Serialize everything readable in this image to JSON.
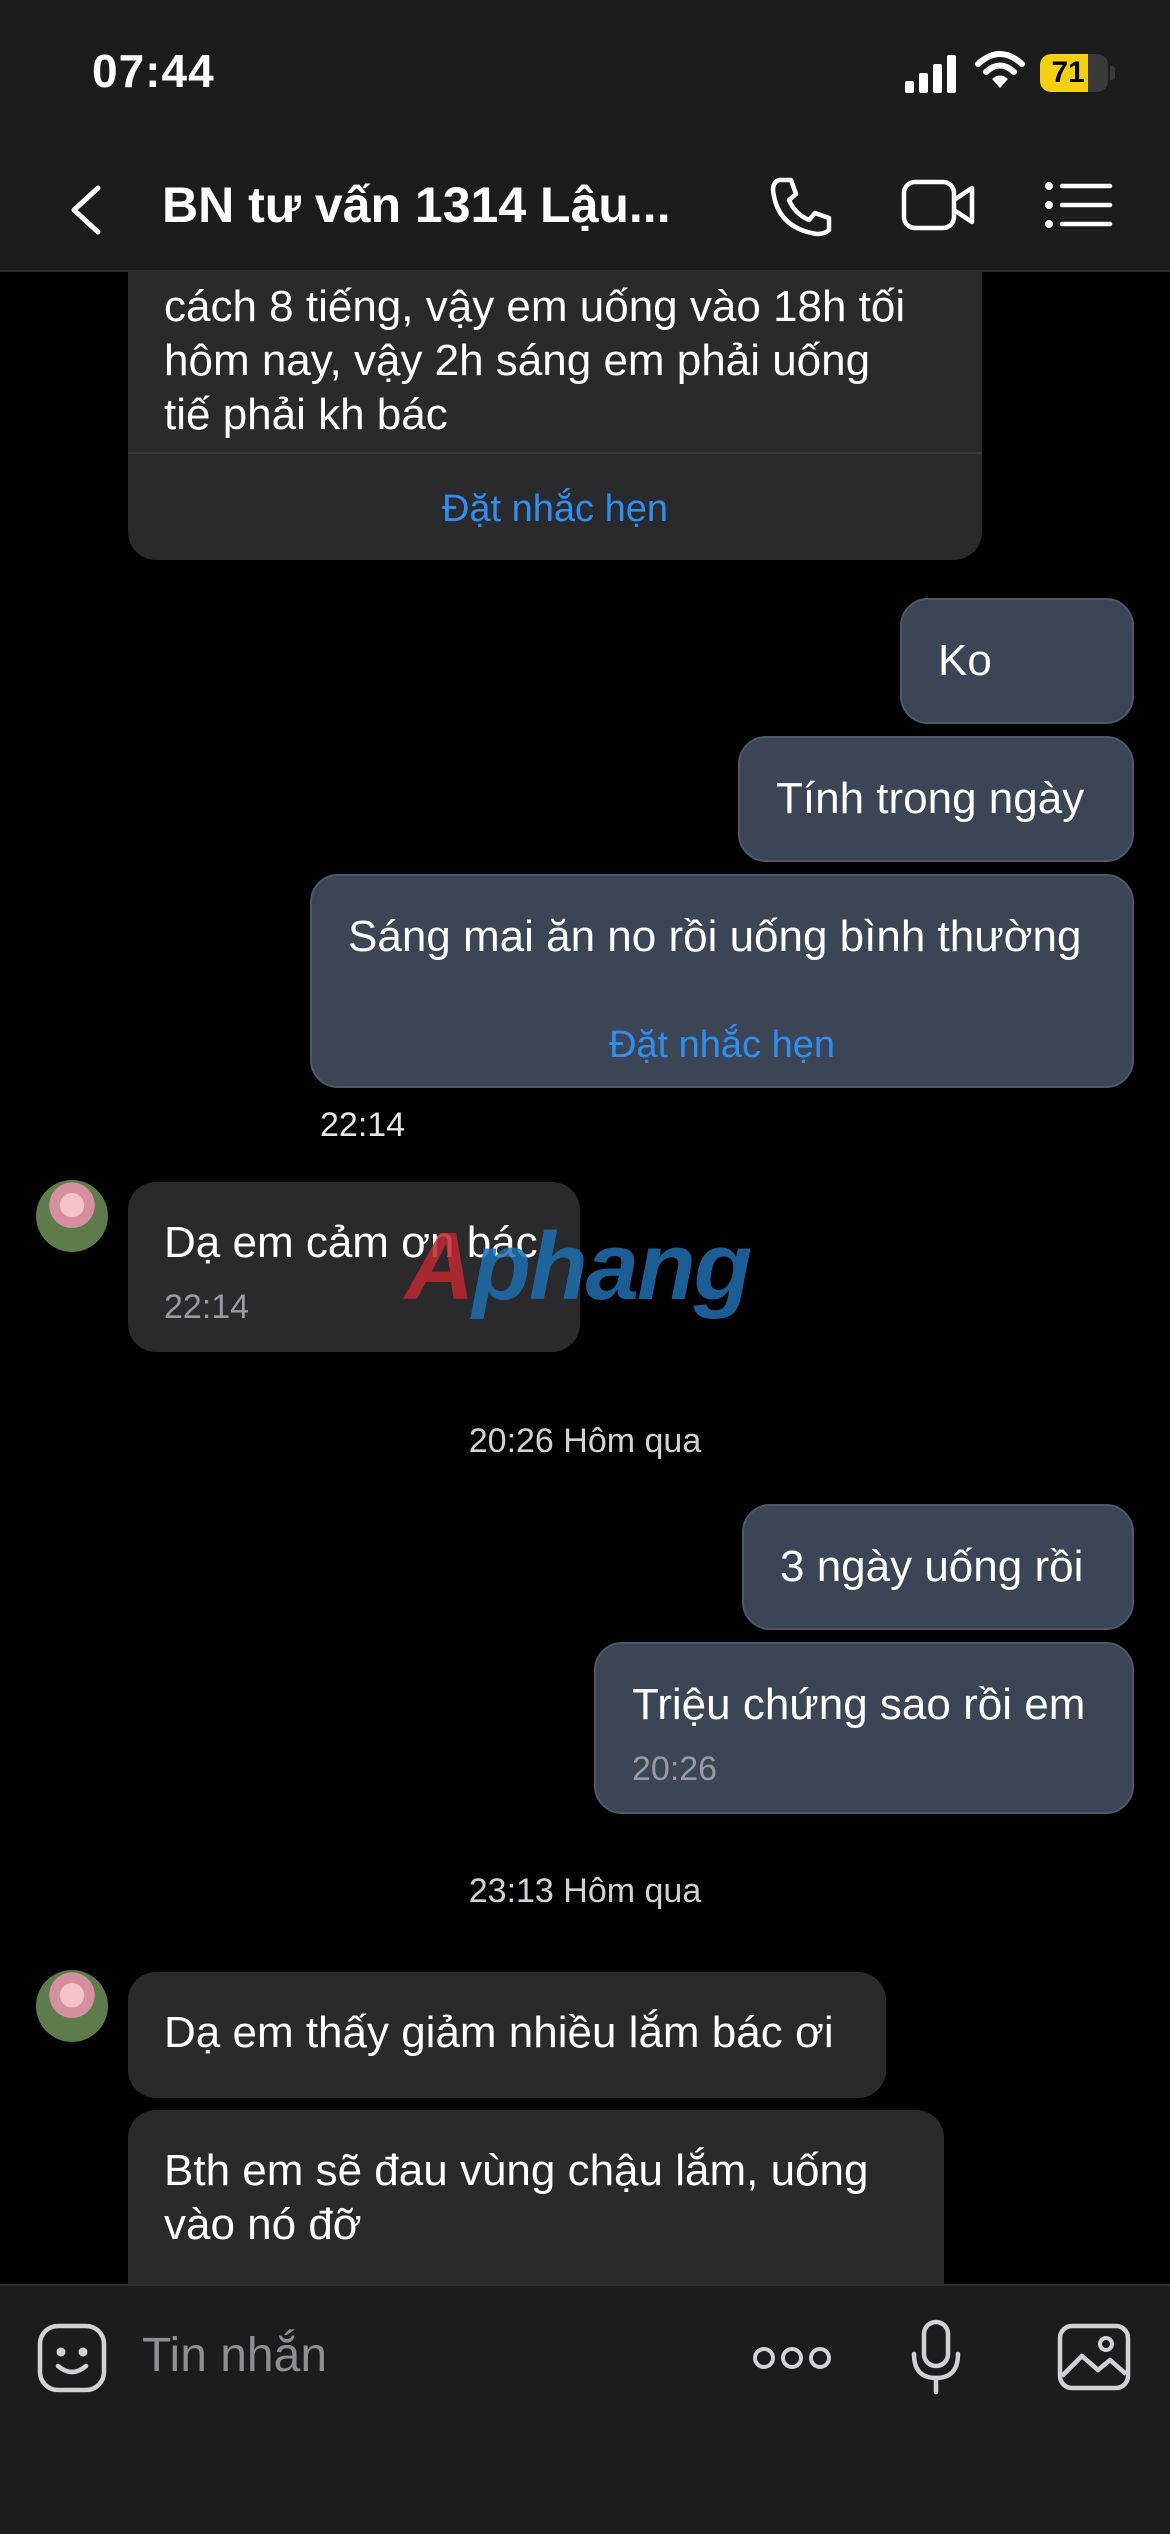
{
  "status_bar": {
    "time": "07:44",
    "battery": "71",
    "battery_level": 0.71
  },
  "header": {
    "title": "BN tư vấn 1314 Lậu...",
    "icons": [
      "chevron-left-icon",
      "phone-icon",
      "video-icon",
      "list-menu-icon"
    ]
  },
  "messages": {
    "m1": {
      "lines": [
        "cách 8 tiếng, vậy em uống vào 18h tối",
        "hôm nay, vậy 2h sáng em phải uống",
        "tiế phải kh bác"
      ],
      "remind_label": "Đặt nhắc hẹn"
    },
    "m2": {
      "text": "Ko"
    },
    "m3": {
      "text": "Tính trong ngày"
    },
    "m4": {
      "text": "Sáng mai ăn no rồi uống bình thường",
      "remind_label": "Đặt nhắc hẹn",
      "time": "22:14"
    },
    "m5": {
      "text": "Dạ em cảm ơn bác",
      "time": "22:14"
    },
    "sep1": "20:26 Hôm qua",
    "m6": {
      "text": "3 ngày uống rồi"
    },
    "m7": {
      "text": "Triệu chứng sao rồi em",
      "time": "20:26"
    },
    "sep2": "23:13 Hôm qua",
    "m8": {
      "text": "Dạ em thấy giảm nhiều lắm bác ơi"
    },
    "m9": {
      "lines": [
        "Bth em sẽ đau vùng chậu lắm, uống",
        "vào nó đỡ"
      ]
    }
  },
  "watermark": {
    "prefix": "A",
    "rest": "phang"
  },
  "composer": {
    "placeholder": "Tin nhắn",
    "icons": [
      "sticker-icon",
      "more-icon",
      "microphone-icon",
      "image-icon"
    ]
  }
}
